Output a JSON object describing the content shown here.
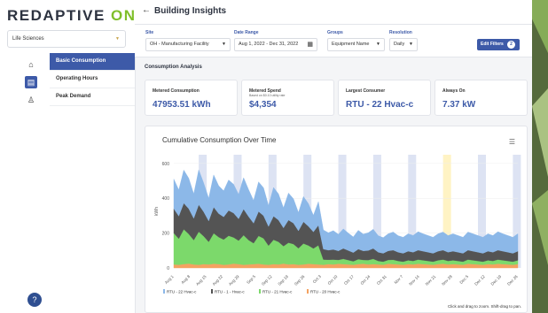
{
  "app": {
    "logo_main": "REDAPTIVE",
    "logo_accent": "ONE",
    "page_title": "Building Insights",
    "back_icon": "arrow-left-icon"
  },
  "sidebar": {
    "org_select": "Life Sciences",
    "rail_icons": [
      "home-icon",
      "building-icon",
      "user-icon"
    ],
    "nav_items": [
      {
        "label": "Basic Consumption",
        "active": true
      },
      {
        "label": "Operating Hours",
        "active": false
      },
      {
        "label": "Peak Demand",
        "active": false
      }
    ],
    "help_label": "?"
  },
  "filters": {
    "site_label": "Site",
    "site_value": "OH - Manufacturing Facility",
    "date_label": "Date Range",
    "date_value": "Aug 1, 2022 - Dec 31, 2022",
    "groups_label": "Groups",
    "groups_value": "Equipment Name",
    "resolution_label": "Resolution",
    "resolution_value": "Daily",
    "edit_label": "Edit Filters",
    "edit_count": "2"
  },
  "analysis": {
    "section_title": "Consumption Analysis",
    "cards": [
      {
        "label": "Metered Consumption",
        "sub": "",
        "value": "47953.51 kWh"
      },
      {
        "label": "Metered Spend",
        "sub": "Based on $0.10 utility rate",
        "value": "$4,354"
      },
      {
        "label": "Largest Consumer",
        "sub": "",
        "value": "RTU - 22 Hvac-c"
      },
      {
        "label": "Always On",
        "sub": "",
        "value": "7.37 kW"
      }
    ]
  },
  "chart_panel": {
    "title": "Cumulative Consumption Over Time",
    "footnote": "Click and drag to zoom. Shift-drag to pan."
  },
  "chart_data": {
    "type": "area",
    "title": "Cumulative Consumption Over Time",
    "ylabel": "kWh",
    "ylim": [
      0,
      650
    ],
    "yticks": [
      0,
      200,
      400,
      600
    ],
    "xticks": [
      "Aug 1",
      "Aug 8",
      "Aug 15",
      "Aug 22",
      "Aug 29",
      "Sep 5",
      "Sep 12",
      "Sep 19",
      "Sep 26",
      "Oct 3",
      "Oct 10",
      "Oct 17",
      "Oct 24",
      "Oct 31",
      "Nov 7",
      "Nov 14",
      "Nov 21",
      "Nov 28",
      "Dec 5",
      "Dec 12",
      "Dec 19",
      "Dec 26"
    ],
    "stacked": true,
    "series": [
      {
        "name": "RTU - 20 Hvac-c",
        "color": "#f4a261",
        "values": [
          20,
          18,
          22,
          25,
          20,
          18,
          22,
          20,
          24,
          22,
          18,
          20,
          25,
          22,
          18,
          20,
          22,
          24,
          20,
          18,
          22,
          20,
          25,
          20,
          22,
          18,
          20,
          24,
          22,
          20,
          18,
          22,
          20,
          24,
          22,
          20,
          18,
          22,
          24,
          20,
          22,
          20,
          18,
          24,
          22,
          20,
          18,
          22,
          20,
          24,
          22,
          20,
          18,
          22,
          24,
          20,
          22,
          20,
          18,
          24,
          22,
          20,
          18,
          22,
          20,
          24,
          22,
          20,
          18,
          22
        ]
      },
      {
        "name": "RTU - 21 Hvac-c",
        "color": "#7cd96b",
        "values": [
          180,
          150,
          200,
          170,
          140,
          190,
          160,
          130,
          175,
          155,
          145,
          165,
          150,
          135,
          170,
          140,
          120,
          160,
          150,
          110,
          140,
          130,
          100,
          125,
          115,
          95,
          120,
          105,
          90,
          110,
          30,
          25,
          28,
          22,
          30,
          25,
          20,
          28,
          22,
          25,
          30,
          20,
          18,
          22,
          25,
          20,
          18,
          22,
          20,
          24,
          22,
          20,
          18,
          22,
          24,
          20,
          22,
          20,
          18,
          24,
          22,
          20,
          18,
          22,
          20,
          24,
          22,
          20,
          18,
          22
        ]
      },
      {
        "name": "RTU - 1 - Hvac-c",
        "color": "#545454",
        "values": [
          140,
          130,
          150,
          145,
          125,
          155,
          140,
          120,
          150,
          135,
          130,
          145,
          140,
          125,
          150,
          135,
          115,
          140,
          130,
          110,
          135,
          125,
          105,
          130,
          120,
          100,
          125,
          110,
          95,
          115,
          60,
          55,
          58,
          52,
          60,
          55,
          50,
          58,
          52,
          55,
          60,
          50,
          48,
          52,
          55,
          50,
          48,
          52,
          50,
          54,
          52,
          50,
          48,
          52,
          54,
          50,
          52,
          50,
          48,
          54,
          52,
          50,
          48,
          52,
          50,
          54,
          52,
          50,
          48,
          52
        ]
      },
      {
        "name": "RTU - 22 Hvac-c",
        "color": "#8cb8e8",
        "values": [
          170,
          150,
          190,
          175,
          140,
          200,
          165,
          130,
          185,
          160,
          150,
          175,
          165,
          140,
          180,
          155,
          130,
          170,
          160,
          120,
          165,
          150,
          115,
          155,
          140,
          105,
          145,
          130,
          95,
          135,
          110,
          100,
          108,
          95,
          112,
          100,
          90,
          108,
          96,
          102,
          110,
          95,
          90,
          98,
          104,
          95,
          92,
          100,
          96,
          106,
          100,
          96,
          92,
          100,
          104,
          96,
          100,
          96,
          92,
          104,
          100,
          96,
          92,
          100,
          96,
          106,
          100,
          96,
          92,
          100
        ]
      }
    ],
    "legend_position": "bottom-left"
  }
}
